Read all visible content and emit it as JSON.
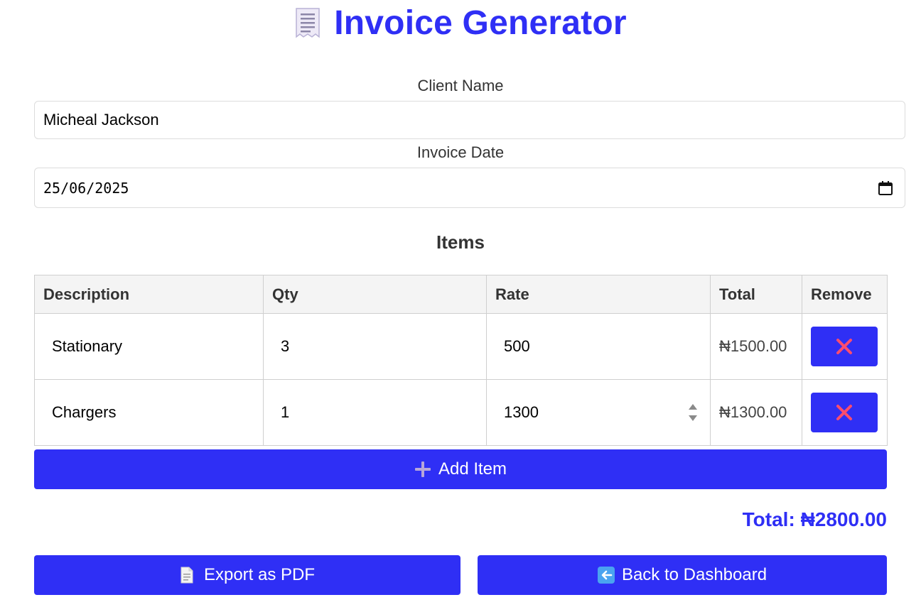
{
  "header": {
    "title": "Invoice Generator",
    "icon": "receipt-icon"
  },
  "form": {
    "client_label": "Client Name",
    "client_value": "Micheal Jackson",
    "date_label": "Invoice Date",
    "date_value": "25/06/2025"
  },
  "items_section": {
    "heading": "Items",
    "columns": [
      "Description",
      "Qty",
      "Rate",
      "Total",
      "Remove"
    ],
    "rows": [
      {
        "description": "Stationary",
        "qty": "3",
        "rate": "500",
        "total": "₦1500.00",
        "remove_icon": "cross-icon"
      },
      {
        "description": "Chargers",
        "qty": "1",
        "rate": "1300",
        "total": "₦1300.00",
        "remove_icon": "cross-icon"
      }
    ],
    "add_label": "Add Item",
    "add_icon": "plus-icon"
  },
  "summary": {
    "total_text": "Total: ₦2800.00"
  },
  "actions": {
    "export_label": "Export as PDF",
    "export_icon": "document-icon",
    "back_label": "Back to Dashboard",
    "back_icon": "back-arrow-icon"
  },
  "colors": {
    "accent": "#2f2ff5",
    "remove_cross": "#ff4d6d"
  }
}
